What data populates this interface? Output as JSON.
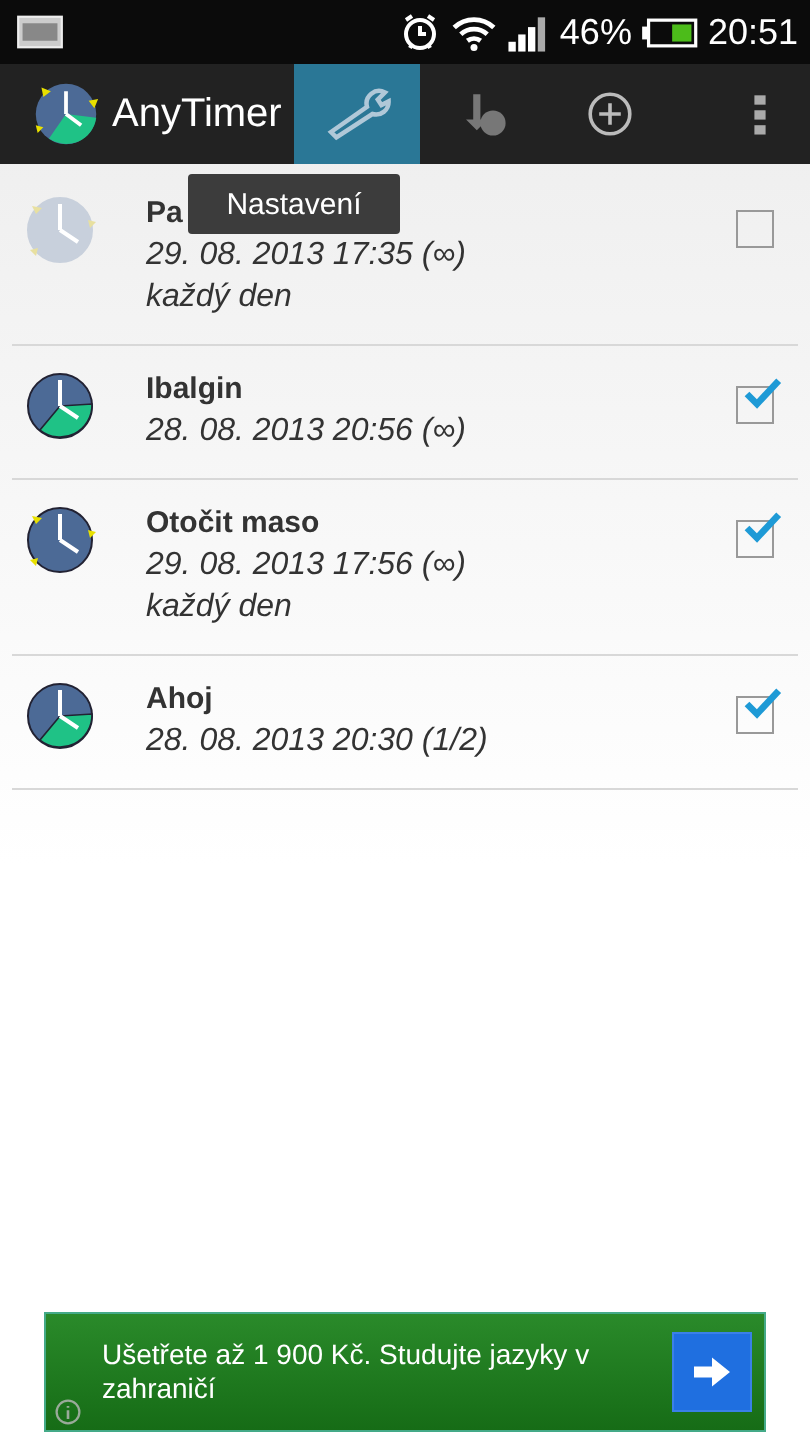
{
  "status_bar": {
    "battery": "46%",
    "time": "20:51"
  },
  "action_bar": {
    "title": "AnyTimer",
    "actions": [
      {
        "kind": "settings",
        "selected": true
      },
      {
        "kind": "stats",
        "selected": false
      },
      {
        "kind": "add",
        "selected": false
      },
      {
        "kind": "overflow",
        "selected": false
      }
    ],
    "tooltip": "Nastavení"
  },
  "timers": [
    {
      "kind": "alarm",
      "title": "Pa",
      "date": "29. 08. 2013 17:35  (∞)",
      "repeat": "každý den",
      "checked": false
    },
    {
      "kind": "timer",
      "title": "Ibalgin",
      "date": "28. 08. 2013 20:56  (∞)",
      "checked": true
    },
    {
      "kind": "alarm",
      "title": "Otočit maso",
      "date": "29. 08. 2013 17:56  (∞)",
      "repeat": "každý den",
      "checked": true
    },
    {
      "kind": "timer",
      "title": "Ahoj",
      "date": "28. 08. 2013 20:30  (1/2)",
      "checked": true
    }
  ],
  "ad": {
    "text": "Ušetřete až 1 900 Kč. Studujte jazyky v zahraničí"
  }
}
